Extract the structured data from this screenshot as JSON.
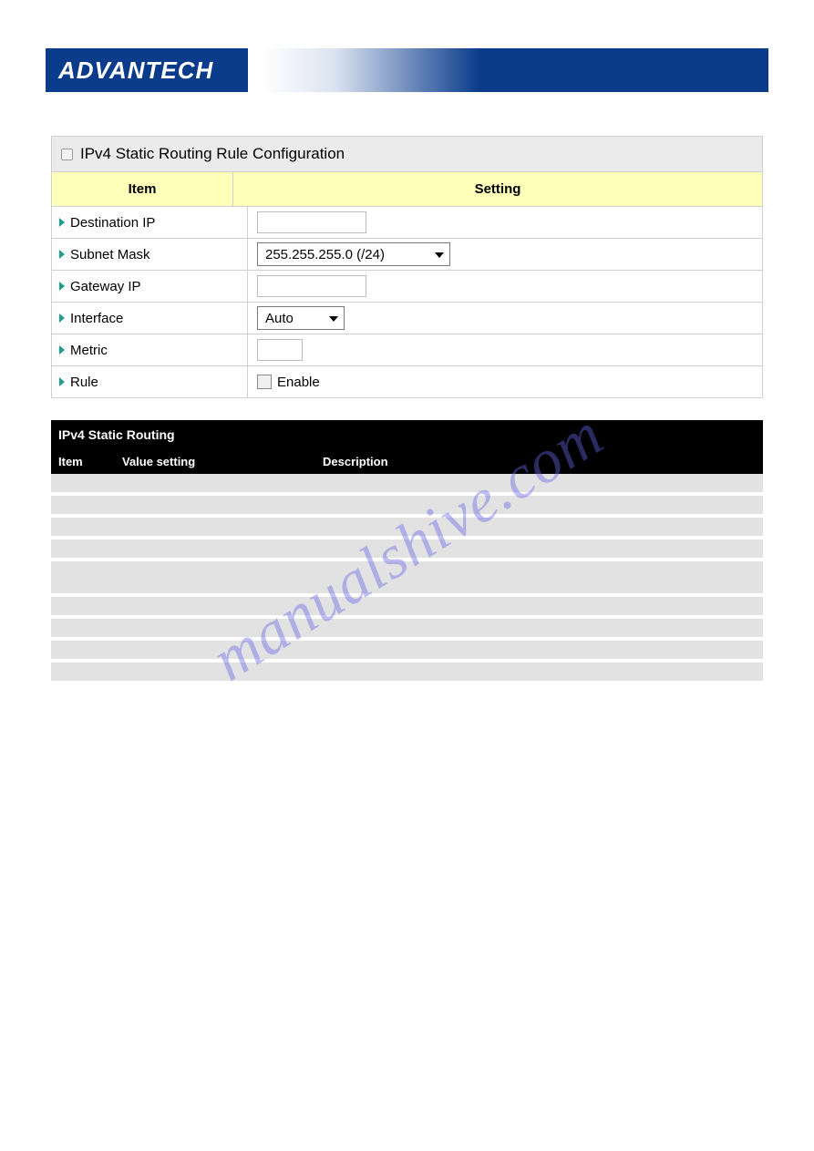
{
  "brand": "ADVANTECH",
  "panel": {
    "title": "IPv4 Static Routing Rule Configuration",
    "columns": {
      "item": "Item",
      "setting": "Setting"
    },
    "rows": {
      "dest_ip": {
        "label": "Destination IP",
        "value": ""
      },
      "subnet": {
        "label": "Subnet Mask",
        "selected": "255.255.255.0 (/24)"
      },
      "gateway": {
        "label": "Gateway IP",
        "value": ""
      },
      "iface": {
        "label": "Interface",
        "selected": "Auto"
      },
      "metric": {
        "label": "Metric",
        "value": ""
      },
      "rule": {
        "label": "Rule",
        "checkbox_label": "Enable",
        "checked": false
      }
    }
  },
  "spec": {
    "title": "IPv4 Static Routing",
    "headers": {
      "item": "Item",
      "value": "Value setting",
      "desc": "Description"
    },
    "rows": [
      {
        "item": "",
        "value": "",
        "desc": ""
      },
      {
        "item": "",
        "value": "",
        "desc": ""
      },
      {
        "item": "",
        "value": "",
        "desc": ""
      },
      {
        "item": "",
        "value": "",
        "desc": ""
      },
      {
        "item": "",
        "value": "",
        "desc": "",
        "underline": true
      },
      {
        "item": "",
        "value": "",
        "desc": ""
      },
      {
        "item": "",
        "value": "",
        "desc": ""
      },
      {
        "item": "",
        "value": "",
        "desc": ""
      },
      {
        "item": "",
        "value": "",
        "desc": ""
      }
    ]
  },
  "watermark": "manualshive.com"
}
